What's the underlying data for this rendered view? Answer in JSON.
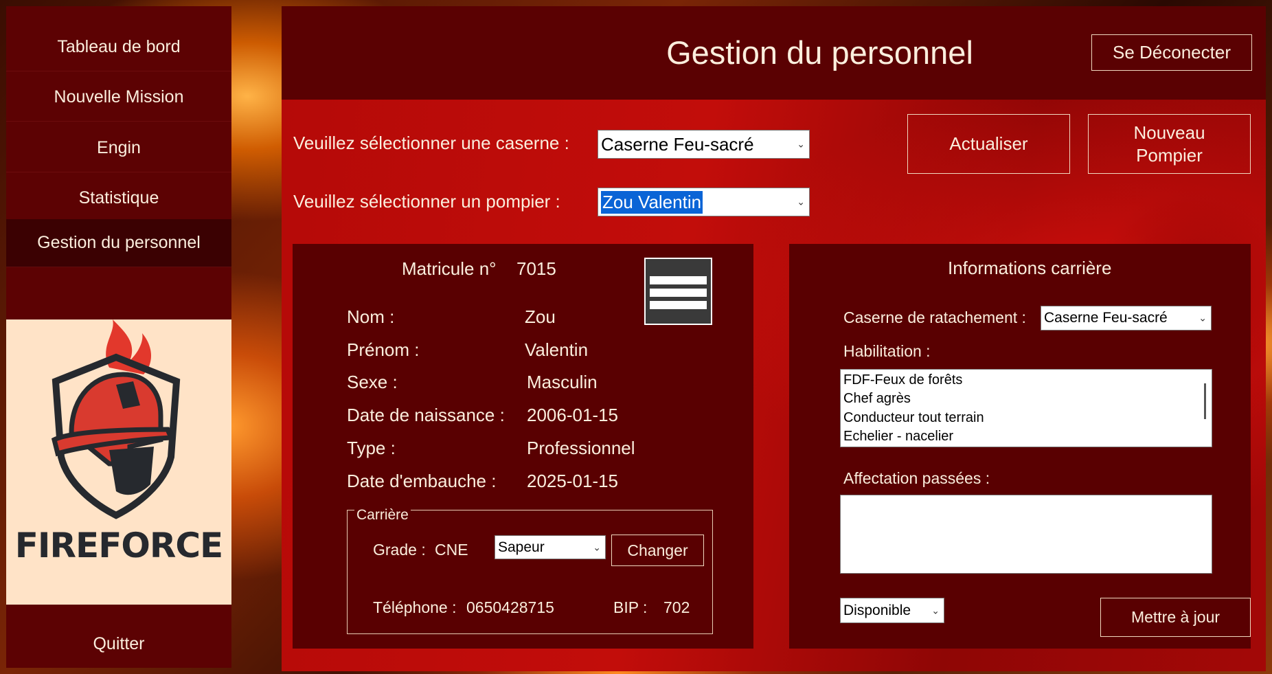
{
  "nav": {
    "items": [
      {
        "label": "Tableau de bord"
      },
      {
        "label": "Nouvelle Mission"
      },
      {
        "label": "Engin"
      },
      {
        "label": "Statistique"
      },
      {
        "label": "Gestion du personnel"
      }
    ],
    "quit_label": "Quitter",
    "logo_text": "FIREFORCE"
  },
  "header": {
    "title": "Gestion du personnel",
    "logout_label": "Se Déconecter"
  },
  "selection": {
    "caserne_label": "Veuillez sélectionner une caserne :",
    "caserne_value": "Caserne Feu-sacré",
    "pompier_label": "Veuillez sélectionner un pompier :",
    "pompier_value": "Zou Valentin",
    "refresh_label": "Actualiser",
    "new_line1": "Nouveau",
    "new_line2": "Pompier"
  },
  "identity": {
    "matricule_label": "Matricule n°",
    "matricule_value": "7015",
    "nom_label": "Nom :",
    "nom_value": "Zou",
    "prenom_label": "Prénom :",
    "prenom_value": "Valentin",
    "sexe_label": "Sexe :",
    "sexe_value": "Masculin",
    "naissance_label": "Date de naissance :",
    "naissance_value": "2006-01-15",
    "type_label": "Type :",
    "type_value": "Professionnel",
    "embauche_label": "Date d'embauche :",
    "embauche_value": "2025-01-15"
  },
  "carriere": {
    "legend": "Carrière",
    "grade_label": "Grade :",
    "grade_code": "CNE",
    "grade_select": "Sapeur",
    "change_label": "Changer",
    "telephone_label": "Téléphone :",
    "telephone_value": "0650428715",
    "bip_label": "BIP :",
    "bip_value": "702"
  },
  "career_info": {
    "title": "Informations carrière",
    "caserne_label": "Caserne de ratachement :",
    "caserne_value": "Caserne Feu-sacré",
    "habilitation_label": "Habilitation :",
    "habilitations": [
      "FDF-Feux de forêts",
      "Chef agrès",
      "Conducteur tout terrain",
      "Echelier - nacelier"
    ],
    "affectations_label": "Affectation passées :",
    "status_value": "Disponible",
    "update_label": "Mettre à jour"
  },
  "colors": {
    "sidebar": "#5c0203",
    "sidebar_active": "#3b0102",
    "panel": "#590001",
    "content_red": "#c20d0a",
    "selection_highlight": "#0a64d6"
  }
}
